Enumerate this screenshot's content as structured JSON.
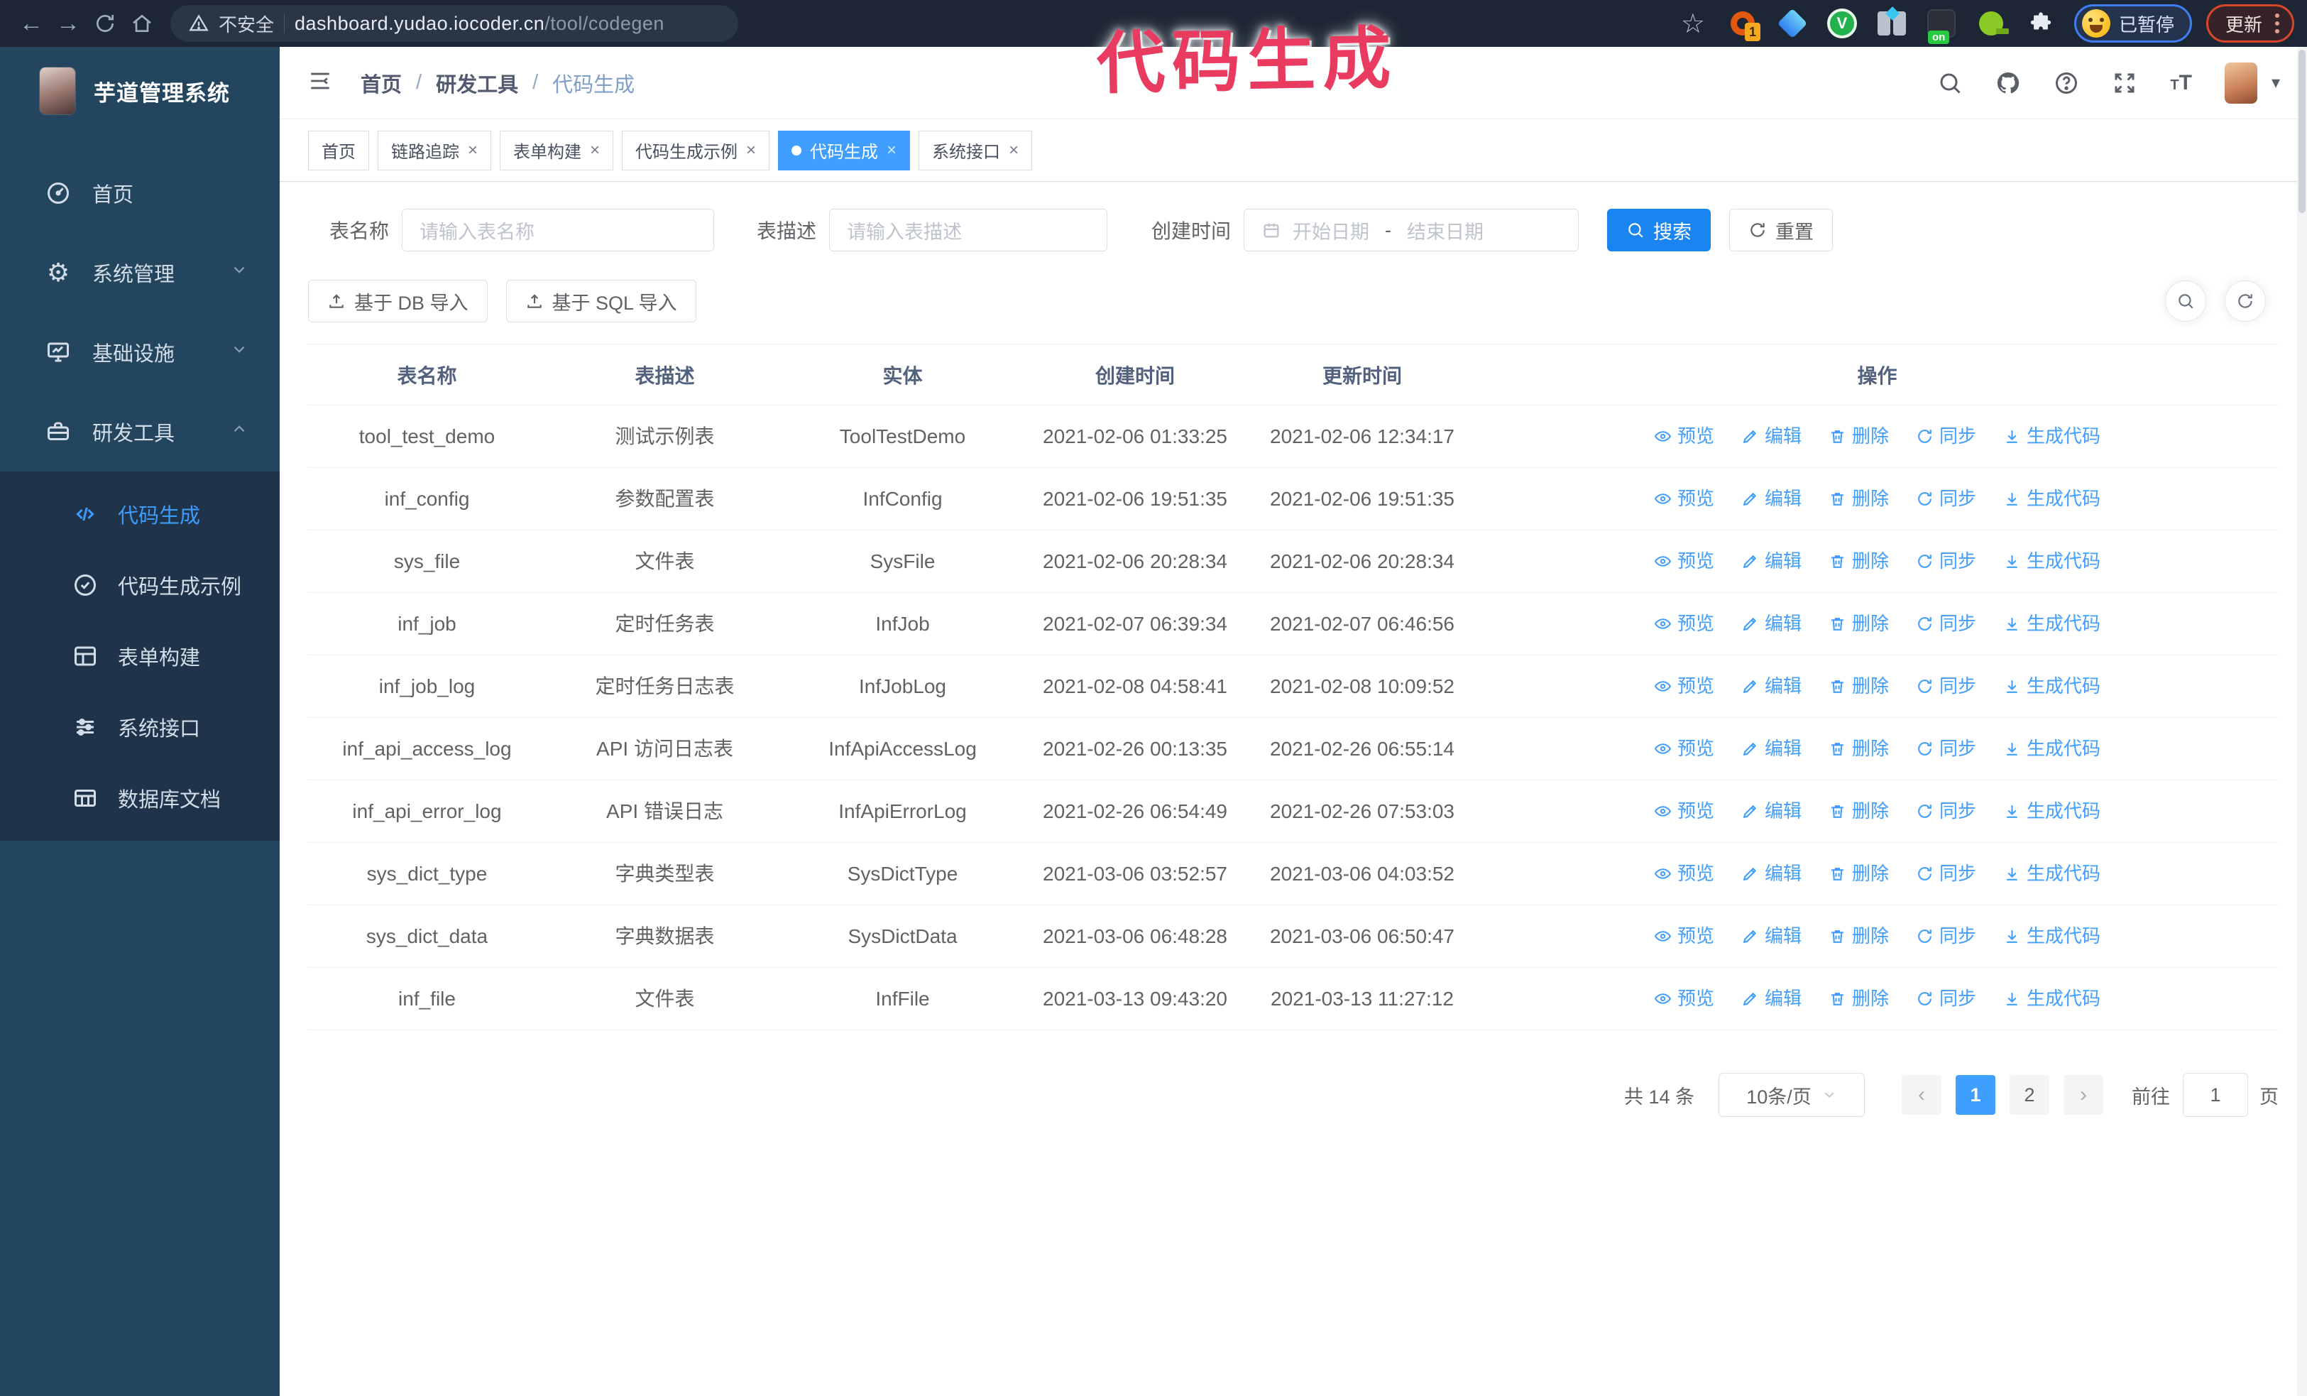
{
  "browser": {
    "url_security": "不安全",
    "url_domain": "dashboard.yudao.iocoder.cn",
    "url_path": "/tool/codegen",
    "extension_badge": "1",
    "extension_on_badge": "on",
    "paused_badge": "已暂停",
    "update_button": "更新"
  },
  "overlay": {
    "annotation": "代码生成"
  },
  "sidebar": {
    "app_title": "芋道管理系统",
    "items": [
      {
        "label": "首页"
      },
      {
        "label": "系统管理"
      },
      {
        "label": "基础设施"
      },
      {
        "label": "研发工具"
      }
    ],
    "submenu": [
      {
        "label": "代码生成",
        "active": true
      },
      {
        "label": "代码生成示例",
        "active": false
      },
      {
        "label": "表单构建",
        "active": false
      },
      {
        "label": "系统接口",
        "active": false
      },
      {
        "label": "数据库文档",
        "active": false
      }
    ]
  },
  "navbar": {
    "breadcrumb": [
      "首页",
      "研发工具",
      "代码生成"
    ]
  },
  "tabs": [
    {
      "label": "首页",
      "closable": false,
      "active": false
    },
    {
      "label": "链路追踪",
      "closable": true,
      "active": false
    },
    {
      "label": "表单构建",
      "closable": true,
      "active": false
    },
    {
      "label": "代码生成示例",
      "closable": true,
      "active": false
    },
    {
      "label": "代码生成",
      "closable": true,
      "active": true
    },
    {
      "label": "系统接口",
      "closable": true,
      "active": false
    }
  ],
  "filters": {
    "table_name_label": "表名称",
    "table_name_placeholder": "请输入表名称",
    "table_desc_label": "表描述",
    "table_desc_placeholder": "请输入表描述",
    "create_time_label": "创建时间",
    "date_start_placeholder": "开始日期",
    "date_separator": "-",
    "date_end_placeholder": "结束日期",
    "search_button": "搜索",
    "reset_button": "重置"
  },
  "toolbar": {
    "import_db_button": "基于 DB 导入",
    "import_sql_button": "基于 SQL 导入"
  },
  "table": {
    "columns": [
      "表名称",
      "表描述",
      "实体",
      "创建时间",
      "更新时间",
      "操作"
    ],
    "actions": [
      "预览",
      "编辑",
      "删除",
      "同步",
      "生成代码"
    ],
    "rows": [
      {
        "name": "tool_test_demo",
        "desc": "测试示例表",
        "entity": "ToolTestDemo",
        "created": "2021-02-06 01:33:25",
        "updated": "2021-02-06 12:34:17"
      },
      {
        "name": "inf_config",
        "desc": "参数配置表",
        "entity": "InfConfig",
        "created": "2021-02-06 19:51:35",
        "updated": "2021-02-06 19:51:35"
      },
      {
        "name": "sys_file",
        "desc": "文件表",
        "entity": "SysFile",
        "created": "2021-02-06 20:28:34",
        "updated": "2021-02-06 20:28:34"
      },
      {
        "name": "inf_job",
        "desc": "定时任务表",
        "entity": "InfJob",
        "created": "2021-02-07 06:39:34",
        "updated": "2021-02-07 06:46:56"
      },
      {
        "name": "inf_job_log",
        "desc": "定时任务日志表",
        "entity": "InfJobLog",
        "created": "2021-02-08 04:58:41",
        "updated": "2021-02-08 10:09:52"
      },
      {
        "name": "inf_api_access_log",
        "desc": "API 访问日志表",
        "entity": "InfApiAccessLog",
        "created": "2021-02-26 00:13:35",
        "updated": "2021-02-26 06:55:14"
      },
      {
        "name": "inf_api_error_log",
        "desc": "API 错误日志",
        "entity": "InfApiErrorLog",
        "created": "2021-02-26 06:54:49",
        "updated": "2021-02-26 07:53:03"
      },
      {
        "name": "sys_dict_type",
        "desc": "字典类型表",
        "entity": "SysDictType",
        "created": "2021-03-06 03:52:57",
        "updated": "2021-03-06 04:03:52"
      },
      {
        "name": "sys_dict_data",
        "desc": "字典数据表",
        "entity": "SysDictData",
        "created": "2021-03-06 06:48:28",
        "updated": "2021-03-06 06:50:47"
      },
      {
        "name": "inf_file",
        "desc": "文件表",
        "entity": "InfFile",
        "created": "2021-03-13 09:43:20",
        "updated": "2021-03-13 11:27:12"
      }
    ]
  },
  "pagination": {
    "total_text": "共 14 条",
    "page_size": "10条/页",
    "pages": [
      "1",
      "2"
    ],
    "active_page": "1",
    "goto_label": "前往",
    "goto_value": "1",
    "page_label": "页"
  },
  "colors": {
    "primary": "#409eff",
    "search_button_blue": "#1a84f0",
    "sidebar_bg": "#24455e",
    "submenu_bg": "#1f344a",
    "browser_bar_bg": "#1d2634",
    "annotation_pink": "#e93a5f",
    "tag_active_bg": "#409eff"
  }
}
